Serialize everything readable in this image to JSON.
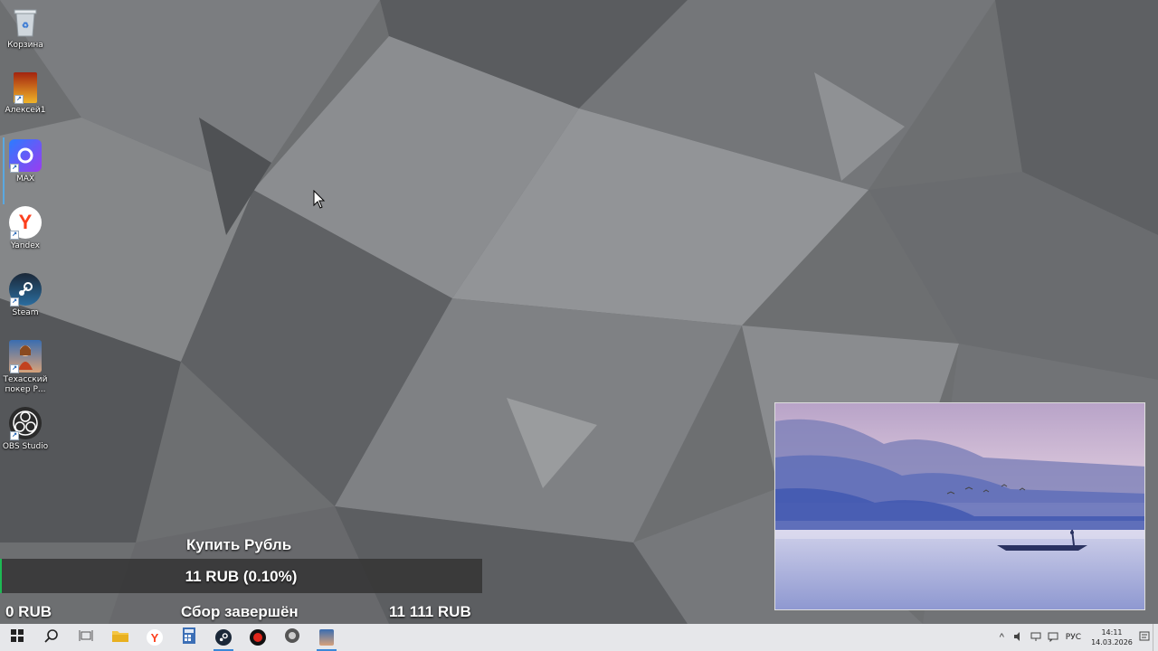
{
  "desktop": {
    "icons": [
      {
        "label": "Корзина",
        "icon": "recycle-bin-icon"
      },
      {
        "label": "Алексей1",
        "icon": "game-icon"
      },
      {
        "label": "MAX",
        "icon": "max-messenger-icon"
      },
      {
        "label": "Yandex",
        "icon": "yandex-browser-icon"
      },
      {
        "label": "Steam",
        "icon": "steam-icon"
      },
      {
        "label": "Техасский покер Р...",
        "icon": "poker-icon"
      },
      {
        "label": "OBS Studio",
        "icon": "obs-icon"
      }
    ]
  },
  "donation_goal": {
    "title": "Купить Рубль",
    "current": "11 RUB (0.10%)",
    "progress_fraction": 0.001,
    "min": "0 RUB",
    "status": "Сбор завершён",
    "max": "11 111 RUB",
    "fill_color": "#1db954"
  },
  "taskbar": {
    "apps": [
      {
        "icon": "windows-start-icon"
      },
      {
        "icon": "search-icon"
      },
      {
        "icon": "task-view-icon"
      },
      {
        "icon": "file-explorer-icon"
      },
      {
        "icon": "yandex-browser-icon"
      },
      {
        "icon": "calculator-icon"
      },
      {
        "icon": "steam-icon"
      },
      {
        "icon": "red-app-icon"
      },
      {
        "icon": "game-icon"
      },
      {
        "icon": "poker-icon"
      }
    ],
    "tray": {
      "language": "РУС",
      "time": "14:11",
      "date": "14.03.2026"
    }
  },
  "colors": {
    "accent": "#3a88d8",
    "taskbar_bg": "#e6e7ea"
  }
}
